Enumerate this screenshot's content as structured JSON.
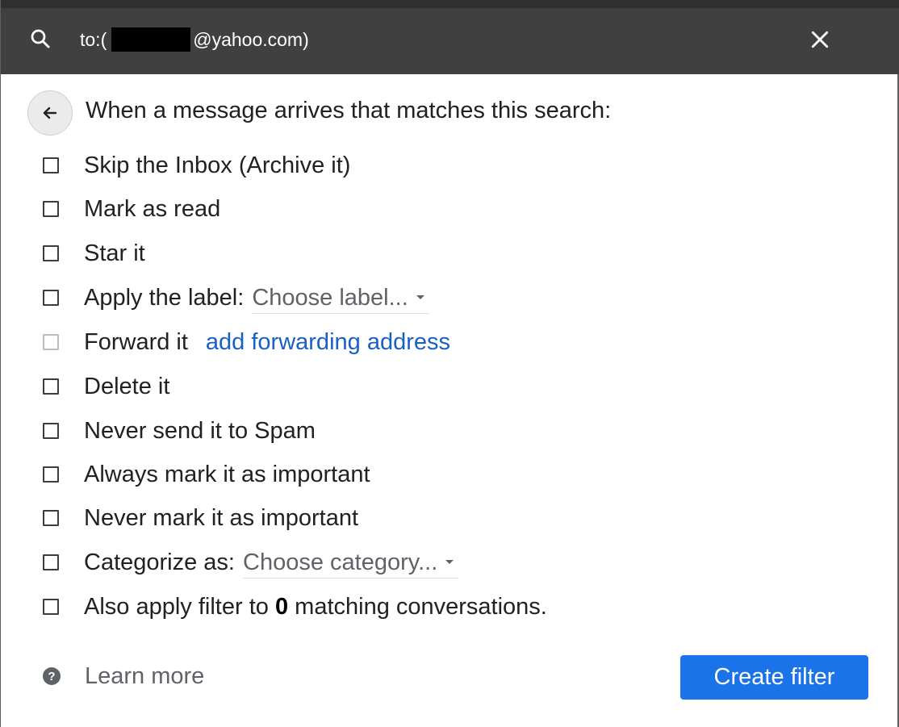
{
  "search": {
    "query_prefix": "to:(",
    "query_suffix": "@yahoo.com)"
  },
  "heading": "When a message arrives that matches this search:",
  "options": [
    {
      "label": "Skip the Inbox (Archive it)"
    },
    {
      "label": "Mark as read"
    },
    {
      "label": "Star it"
    },
    {
      "label": "Apply the label:",
      "select": "Choose label..."
    },
    {
      "label": "Forward it",
      "link": "add forwarding address",
      "disabled": true
    },
    {
      "label": "Delete it"
    },
    {
      "label": "Never send it to Spam"
    },
    {
      "label": "Always mark it as important"
    },
    {
      "label": "Never mark it as important"
    },
    {
      "label": "Categorize as:",
      "select": "Choose category..."
    },
    {
      "label_before": "Also apply filter to",
      "count": "0",
      "label_after": "matching conversations."
    }
  ],
  "footer": {
    "learn_more": "Learn more",
    "create_filter": "Create filter"
  },
  "icons": {
    "search": "search-icon",
    "close": "close-icon",
    "back": "arrow-left-icon",
    "help": "help-circle-icon"
  },
  "colors": {
    "header_bg": "#404040",
    "primary_button": "#1a73e8",
    "link": "#1a5fc7"
  }
}
